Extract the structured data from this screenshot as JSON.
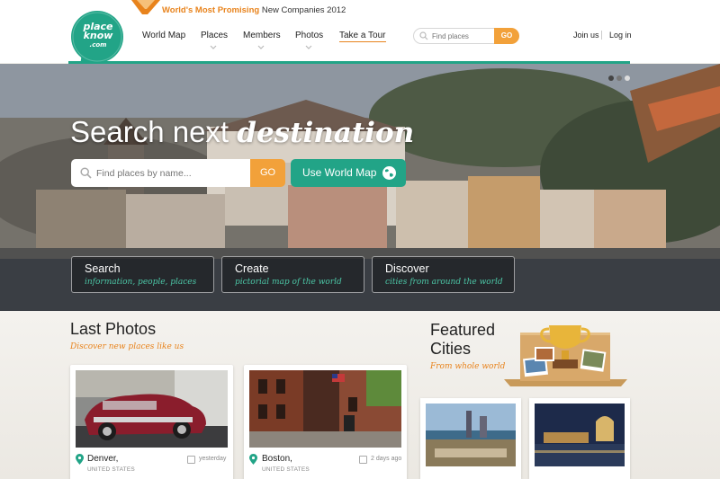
{
  "header": {
    "logo_text": [
      "place",
      "know",
      ".com"
    ],
    "award_highlight": "World's Most Promising",
    "award_rest": "New Companies 2012",
    "nav": [
      "World Map",
      "Places",
      "Members",
      "Photos",
      "Take a Tour"
    ],
    "search_placeholder": "Find places",
    "search_go": "GO",
    "join": "Join us",
    "login": "Log in"
  },
  "hero": {
    "title_plain": "Search next",
    "title_script": "destination",
    "search_placeholder": "Find places by name...",
    "go": "GO",
    "world_map_button": "Use World Map",
    "features": [
      {
        "title": "Search",
        "subtitle": "information, people, places"
      },
      {
        "title": "Create",
        "subtitle": "pictorial map of the world"
      },
      {
        "title": "Discover",
        "subtitle": "cities from around the world"
      }
    ]
  },
  "last_photos": {
    "title": "Last Photos",
    "subtitle": "Discover new places like us",
    "items": [
      {
        "city": "Denver,",
        "country": "UNITED STATES",
        "time": "yesterday"
      },
      {
        "city": "Boston,",
        "country": "UNITED STATES",
        "time": "2 days ago"
      }
    ]
  },
  "featured": {
    "title_line1": "Featured",
    "title_line2": "Cities",
    "subtitle": "From whole world"
  },
  "colors": {
    "brand_green": "#22a487",
    "accent_orange": "#f2a13a",
    "award_orange": "#e8831c"
  },
  "icons": [
    "search-icon",
    "globe-icon",
    "location-pin-icon",
    "clock-icon",
    "trophy-icon",
    "chevron-down-icon"
  ]
}
